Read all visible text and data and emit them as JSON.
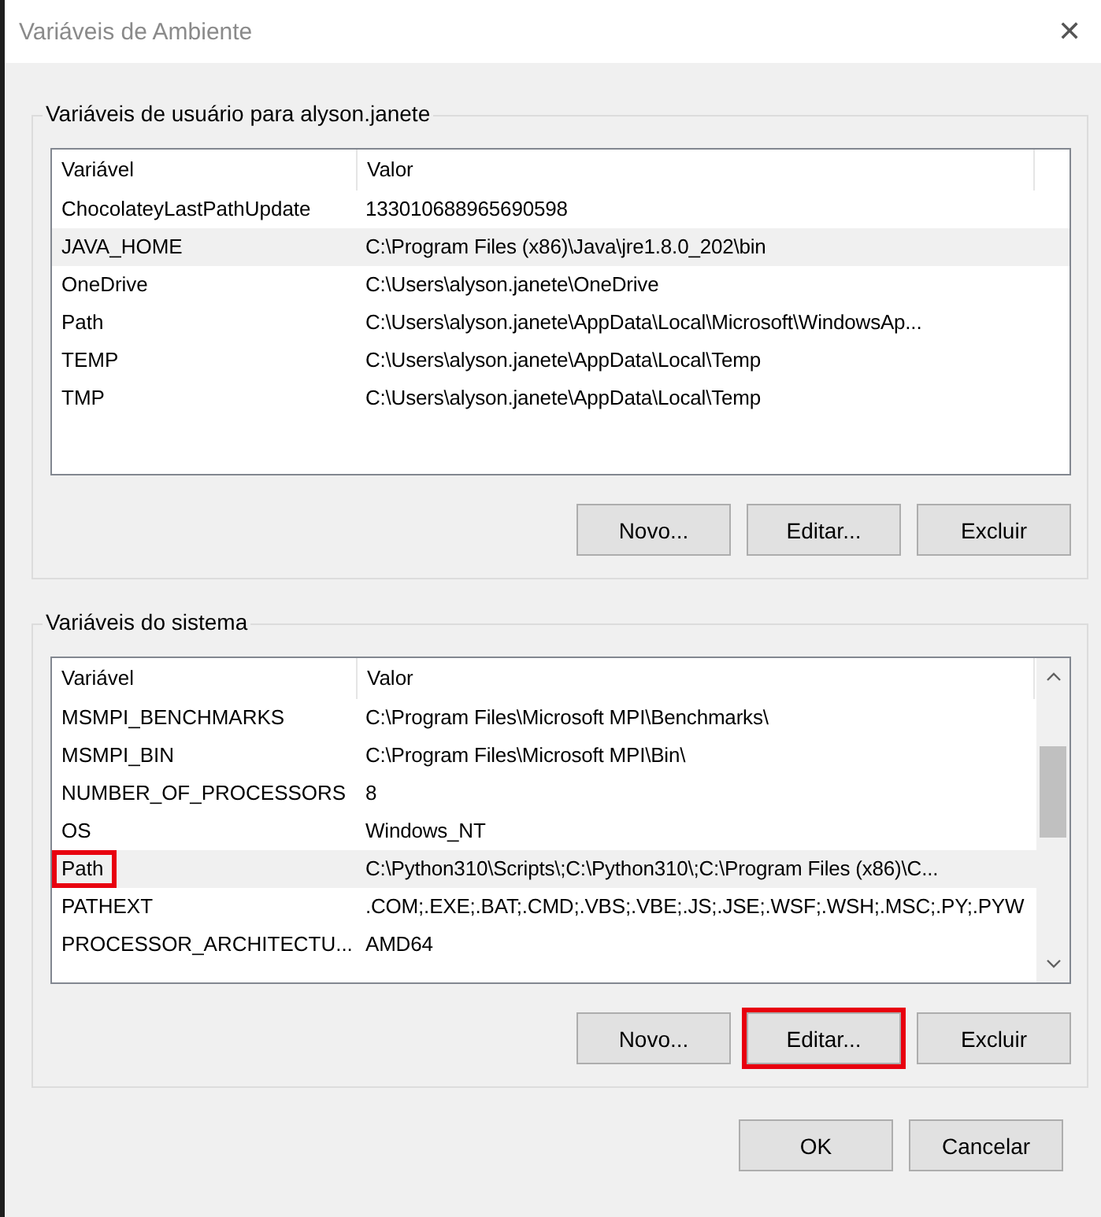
{
  "window": {
    "title": "Variáveis de Ambiente",
    "close": "✕"
  },
  "user_variables": {
    "title": "Variáveis de usuário para alyson.janete",
    "columns": [
      "Variável",
      "Valor"
    ],
    "rows": [
      {
        "name": "ChocolateyLastPathUpdate",
        "value": "133010688965690598",
        "selected": false,
        "highlighted": false
      },
      {
        "name": "JAVA_HOME",
        "value": "C:\\Program Files (x86)\\Java\\jre1.8.0_202\\bin",
        "selected": true,
        "highlighted": false
      },
      {
        "name": "OneDrive",
        "value": "C:\\Users\\alyson.janete\\OneDrive",
        "selected": false,
        "highlighted": false
      },
      {
        "name": "Path",
        "value": "C:\\Users\\alyson.janete\\AppData\\Local\\Microsoft\\WindowsAp...",
        "selected": false,
        "highlighted": false
      },
      {
        "name": "TEMP",
        "value": "C:\\Users\\alyson.janete\\AppData\\Local\\Temp",
        "selected": false,
        "highlighted": false
      },
      {
        "name": "TMP",
        "value": "C:\\Users\\alyson.janete\\AppData\\Local\\Temp",
        "selected": false,
        "highlighted": false
      }
    ],
    "scrollbar": false,
    "buttons": [
      {
        "label": "Novo...",
        "highlighted": false
      },
      {
        "label": "Editar...",
        "highlighted": false
      },
      {
        "label": "Excluir",
        "highlighted": false
      }
    ]
  },
  "system_variables": {
    "title": "Variáveis do sistema",
    "columns": [
      "Variável",
      "Valor"
    ],
    "rows": [
      {
        "name": "MSMPI_BENCHMARKS",
        "value": "C:\\Program Files\\Microsoft MPI\\Benchmarks\\",
        "selected": false,
        "highlighted": false
      },
      {
        "name": "MSMPI_BIN",
        "value": "C:\\Program Files\\Microsoft MPI\\Bin\\",
        "selected": false,
        "highlighted": false
      },
      {
        "name": "NUMBER_OF_PROCESSORS",
        "value": "8",
        "selected": false,
        "highlighted": false
      },
      {
        "name": "OS",
        "value": "Windows_NT",
        "selected": false,
        "highlighted": false
      },
      {
        "name": "Path",
        "value": "C:\\Python310\\Scripts\\;C:\\Python310\\;C:\\Program Files (x86)\\C...",
        "selected": true,
        "highlighted": true
      },
      {
        "name": "PATHEXT",
        "value": ".COM;.EXE;.BAT;.CMD;.VBS;.VBE;.JS;.JSE;.WSF;.WSH;.MSC;.PY;.PYW",
        "selected": false,
        "highlighted": false
      },
      {
        "name": "PROCESSOR_ARCHITECTU...",
        "value": "AMD64",
        "selected": false,
        "highlighted": false
      }
    ],
    "scrollbar": true,
    "buttons": [
      {
        "label": "Novo...",
        "highlighted": false
      },
      {
        "label": "Editar...",
        "highlighted": true
      },
      {
        "label": "Excluir",
        "highlighted": false
      }
    ]
  },
  "buttons": [
    {
      "label": "OK"
    },
    {
      "label": "Cancelar"
    }
  ]
}
